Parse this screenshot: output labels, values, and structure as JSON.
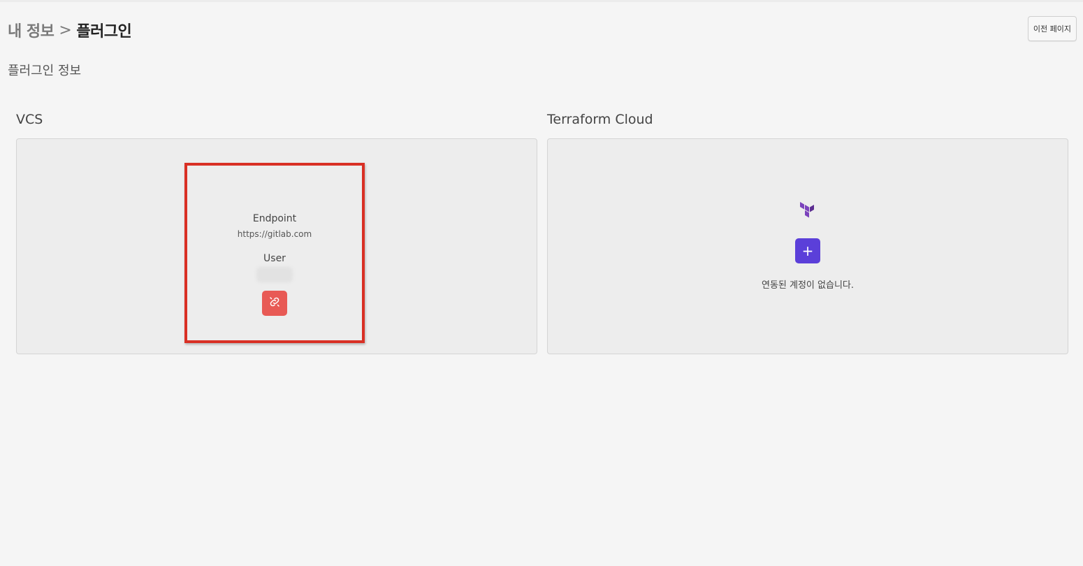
{
  "breadcrumb": {
    "parent": "내 정보",
    "separator": ">",
    "current": "플러그인"
  },
  "header": {
    "back_button_label": "이전 페이지"
  },
  "section_title": "플러그인 정보",
  "vcs": {
    "title": "VCS",
    "endpoint_label": "Endpoint",
    "endpoint_value": "https://gitlab.com",
    "user_label": "User",
    "unlink_icon": "unlink-icon",
    "highlight_color": "#d93025",
    "button_color": "#e85a55"
  },
  "terraform": {
    "title": "Terraform Cloud",
    "logo_icon": "terraform-logo-icon",
    "add_button_label": "+",
    "empty_message": "연동된 계정이 없습니다.",
    "button_color": "#5b3fd9",
    "logo_color": "#7b42bc"
  }
}
